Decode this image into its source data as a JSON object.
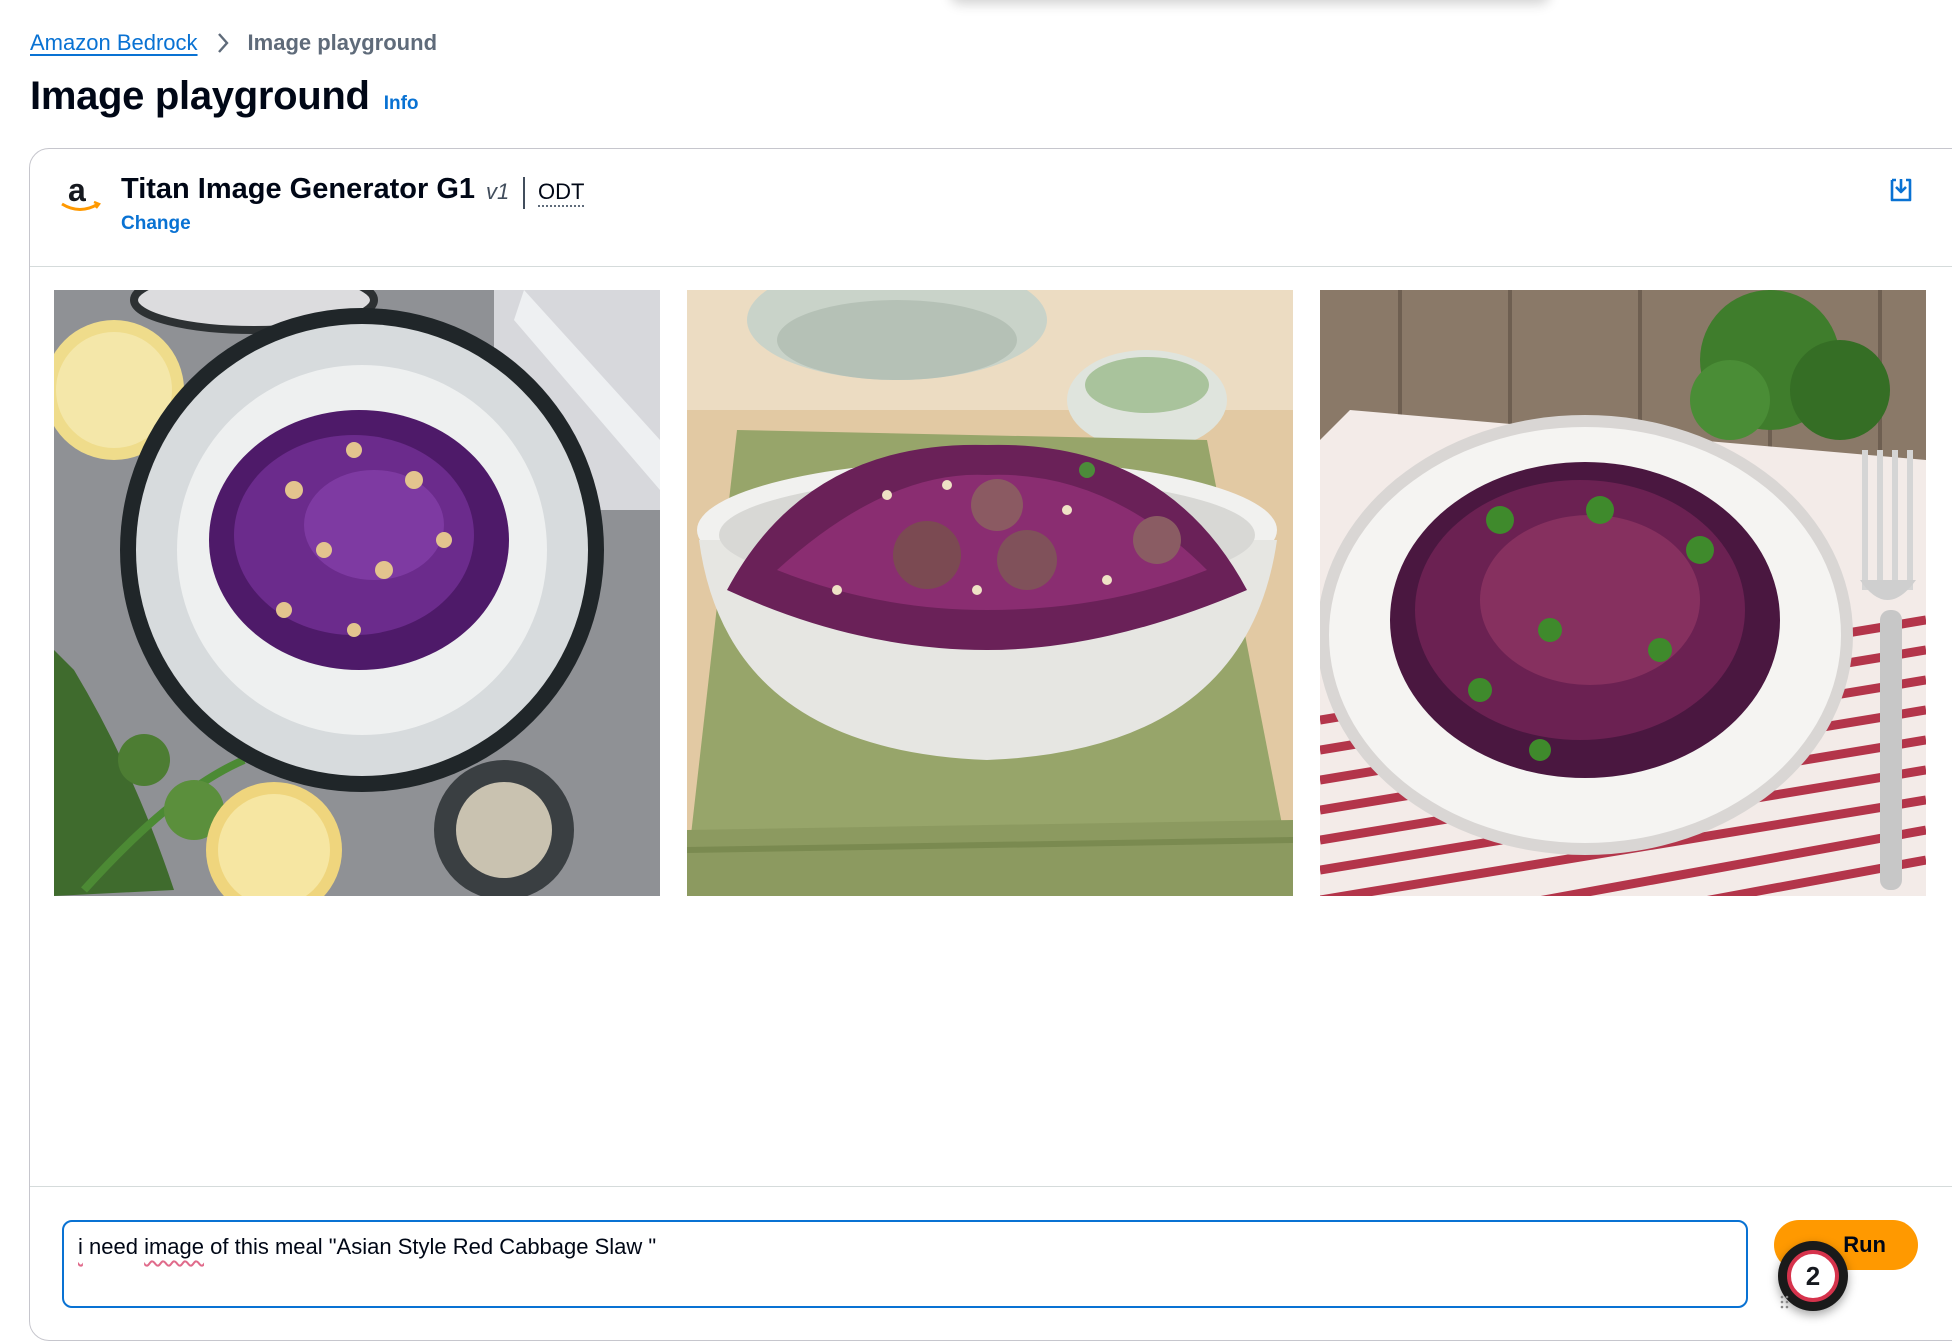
{
  "breadcrumb": {
    "root": "Amazon Bedrock",
    "current": "Image playground"
  },
  "page": {
    "title": "Image playground",
    "info": "Info"
  },
  "model": {
    "name": "Titan Image Generator G1",
    "version": "v1",
    "tag": "ODT",
    "change": "Change"
  },
  "gallery": {
    "images": [
      {
        "name": "generated-image-1",
        "subject": "red cabbage slaw with peanuts in dark bowl, lemons and parsley"
      },
      {
        "name": "generated-image-2",
        "subject": "red cabbage slaw with olives and pine nuts in white bowl on green napkin"
      },
      {
        "name": "generated-image-3",
        "subject": "red cabbage slaw with cilantro on white plate, striped napkin and fork"
      }
    ]
  },
  "prompt": {
    "w1": "i",
    "w2": "need",
    "w3": "image",
    "rest": "of this meal \"Asian Style Red Cabbage Slaw \""
  },
  "actions": {
    "run": "Run",
    "badge_count": "2"
  },
  "icons": {
    "breadcrumb_separator": "chevron-right-icon",
    "save": "download-icon",
    "logo": "amazon-logo"
  },
  "colors": {
    "link": "#0972d3",
    "run_button": "#ff9900",
    "badge_ring": "#d6334c"
  }
}
